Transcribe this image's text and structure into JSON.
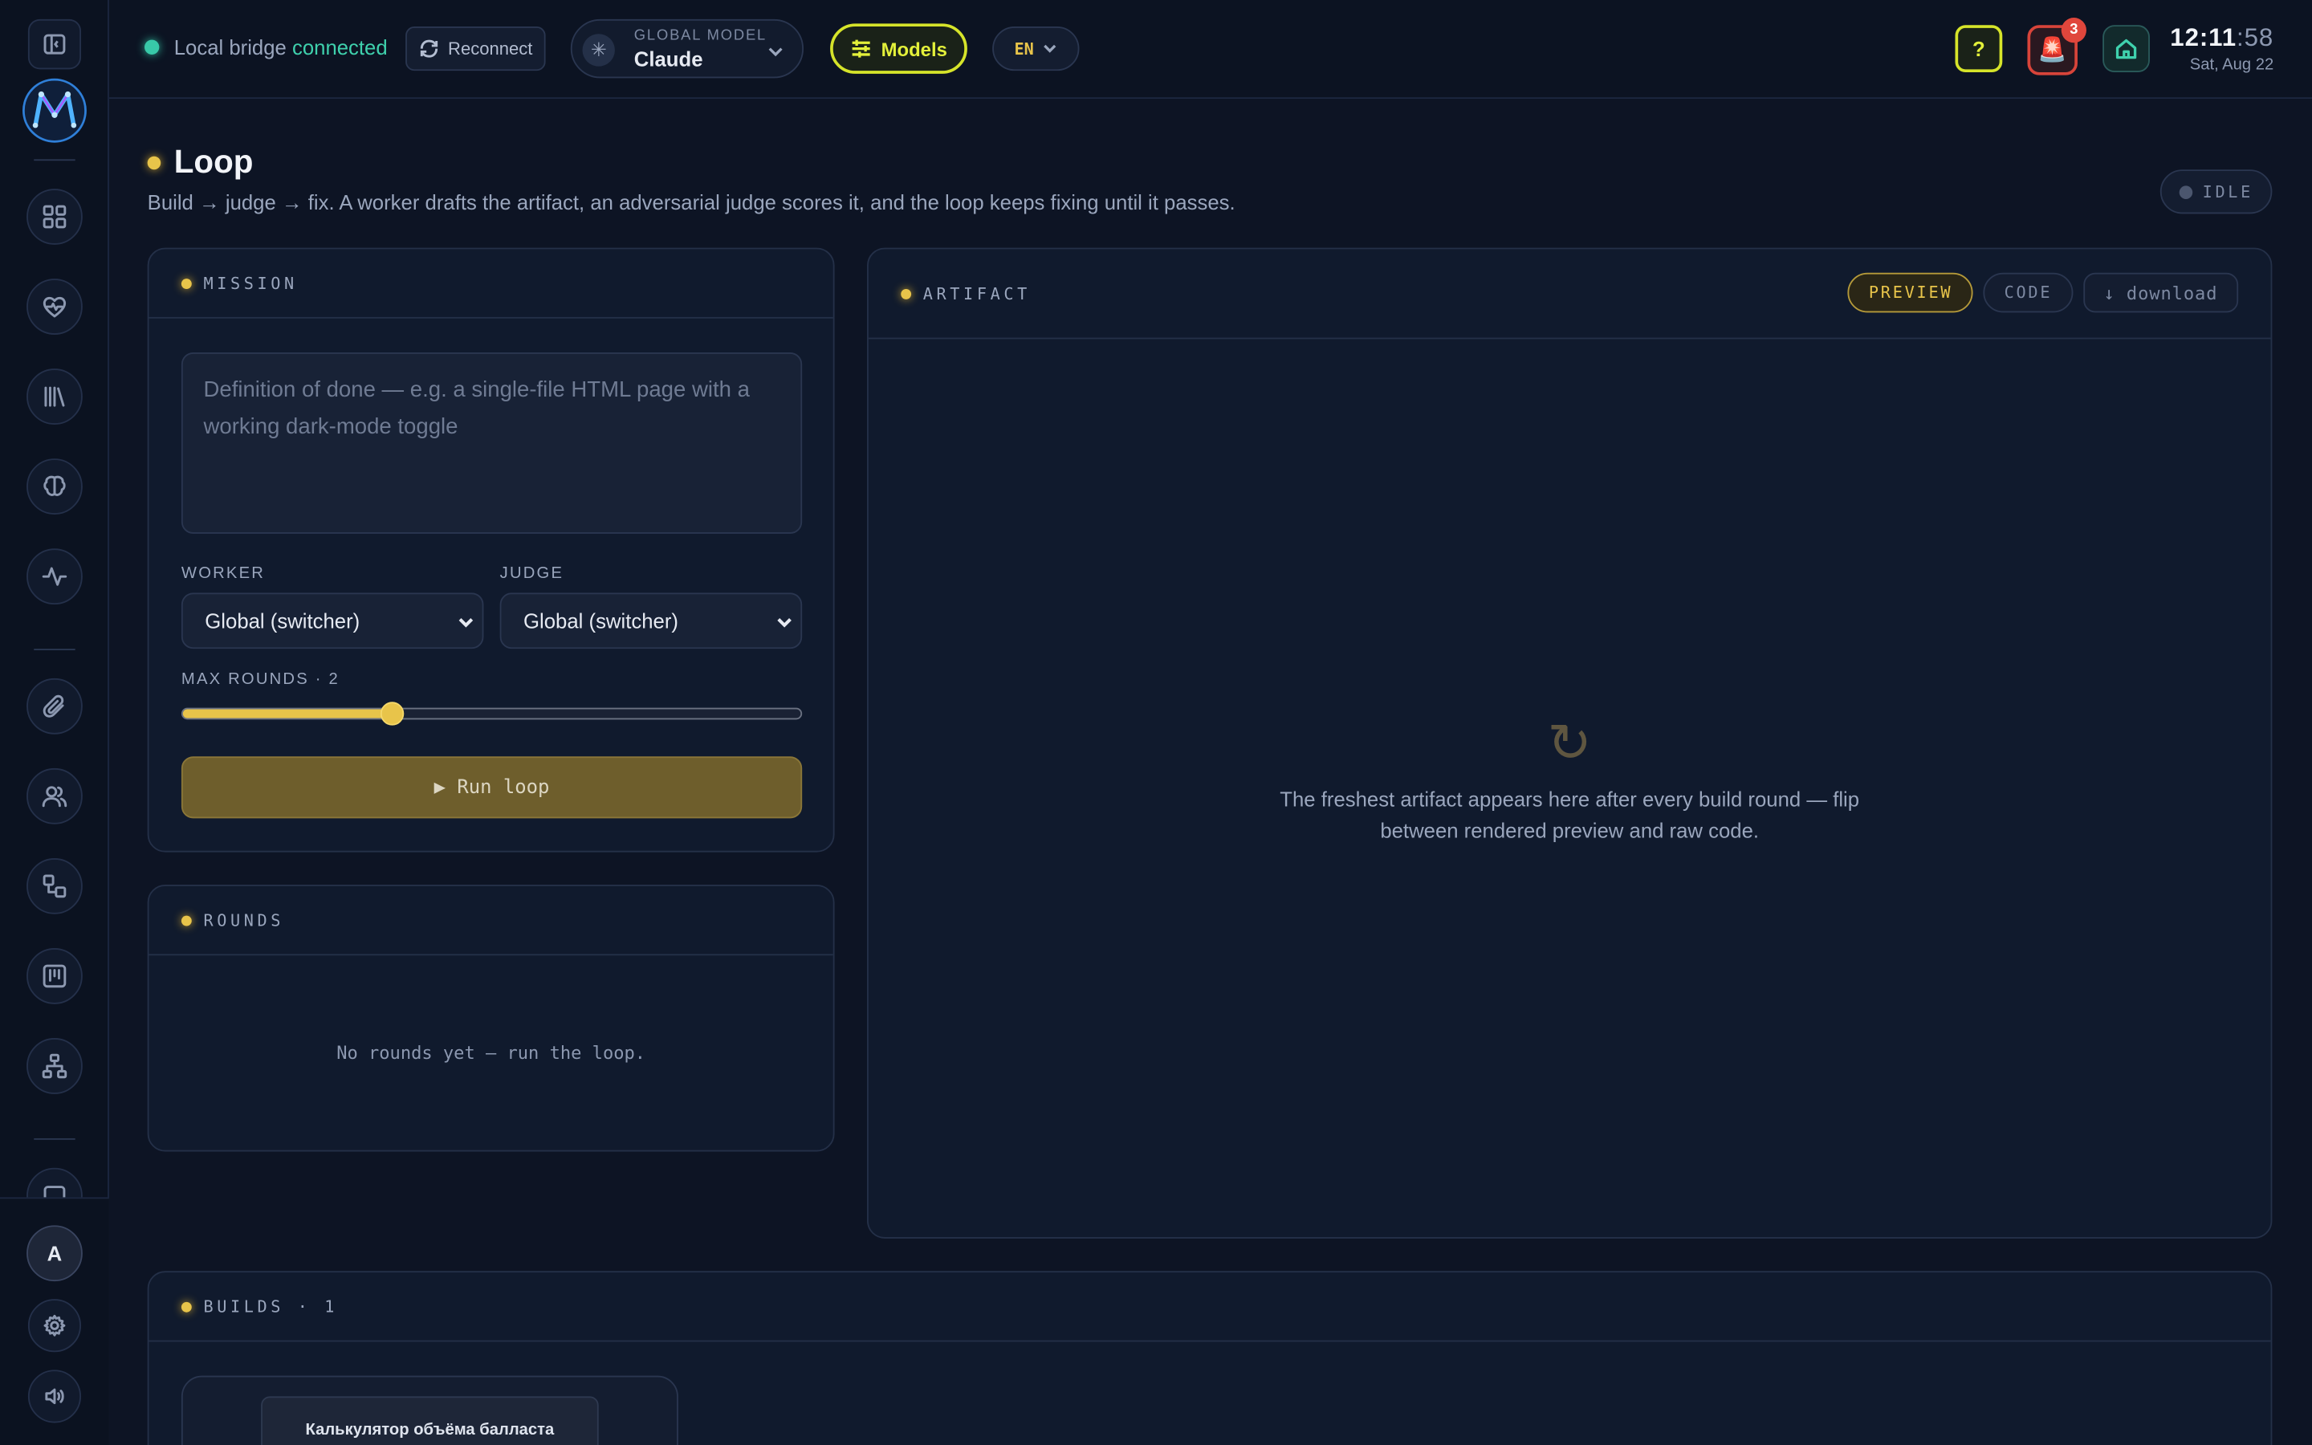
{
  "topbar": {
    "bridge_label": "Local bridge",
    "bridge_status": "connected",
    "reconnect_label": "Reconnect",
    "global_model_label": "GLOBAL MODEL",
    "global_model_value": "Claude",
    "models_label": "Models",
    "lang": "EN",
    "help_label": "?",
    "alerts_count": "3",
    "time_hm": "12:11",
    "time_sep": ":",
    "time_s": "58",
    "date": "Sat, Aug 22"
  },
  "sidebar": {
    "avatar_initial": "A",
    "items": [
      "dashboard",
      "health",
      "library",
      "brain",
      "activity",
      "attachments",
      "people",
      "workflow",
      "board",
      "org-chart",
      "chat"
    ]
  },
  "page": {
    "title": "Loop",
    "subtitle": "Build → judge → fix. A worker drafts the artifact, an adversarial judge scores it, and the loop keeps fixing until it passes.",
    "status": "IDLE"
  },
  "mission": {
    "header": "MISSION",
    "placeholder": "Definition of done — e.g. a single-file HTML page with a working dark-mode toggle",
    "worker_label": "WORKER",
    "worker_value": "Global (switcher)",
    "judge_label": "JUDGE",
    "judge_value": "Global (switcher)",
    "max_rounds_label": "MAX ROUNDS · 2",
    "max_rounds": 2,
    "max_rounds_fraction": 0.34,
    "run_label": "▶  Run loop"
  },
  "rounds": {
    "header": "ROUNDS",
    "empty": "No rounds yet — run the loop."
  },
  "artifact": {
    "header": "ARTIFACT",
    "tab_preview": "PREVIEW",
    "tab_code": "CODE",
    "download_label": "↓ download",
    "empty_icon": "↻",
    "empty_line1": "The freshest artifact appears here after every build round — flip",
    "empty_line2": "between rendered preview and raw code."
  },
  "builds": {
    "header": "BUILDS · 1",
    "items": [
      {
        "title": "Калькулятор объёма балласта"
      }
    ]
  },
  "colors": {
    "accent_yellow": "#e8c44a",
    "accent_lime": "#e3f03a",
    "status_green": "#3fd1ad",
    "alert_red": "#e0463c",
    "background": "#0d1424"
  }
}
